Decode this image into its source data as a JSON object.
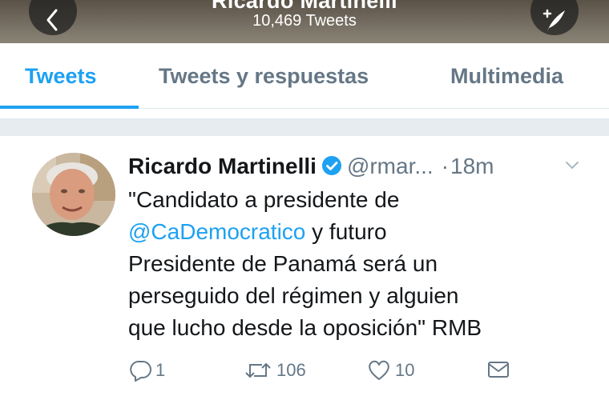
{
  "header": {
    "title": "Ricardo Martinelli",
    "subtitle": "10,469 Tweets"
  },
  "tabs": [
    {
      "label": "Tweets",
      "active": true
    },
    {
      "label": "Tweets y respuestas",
      "active": false
    },
    {
      "label": "Multimedia",
      "active": false
    }
  ],
  "tweet": {
    "name": "Ricardo Martinelli",
    "handle": "@rmar...",
    "separator": "·",
    "time": "18m",
    "text": {
      "line1": "\"Candidato a presidente de",
      "mention": "@CaDemocratico",
      "line2_rest": " y futuro",
      "line3": "Presidente de Panamá será un",
      "line4": "perseguido del régimen y alguien",
      "line5": "que lucho desde la oposición\" RMB"
    },
    "replies": "1",
    "retweets": "106",
    "likes": "10"
  },
  "colors": {
    "accent": "#1da1f2",
    "muted": "#657786",
    "text": "#14171a"
  }
}
